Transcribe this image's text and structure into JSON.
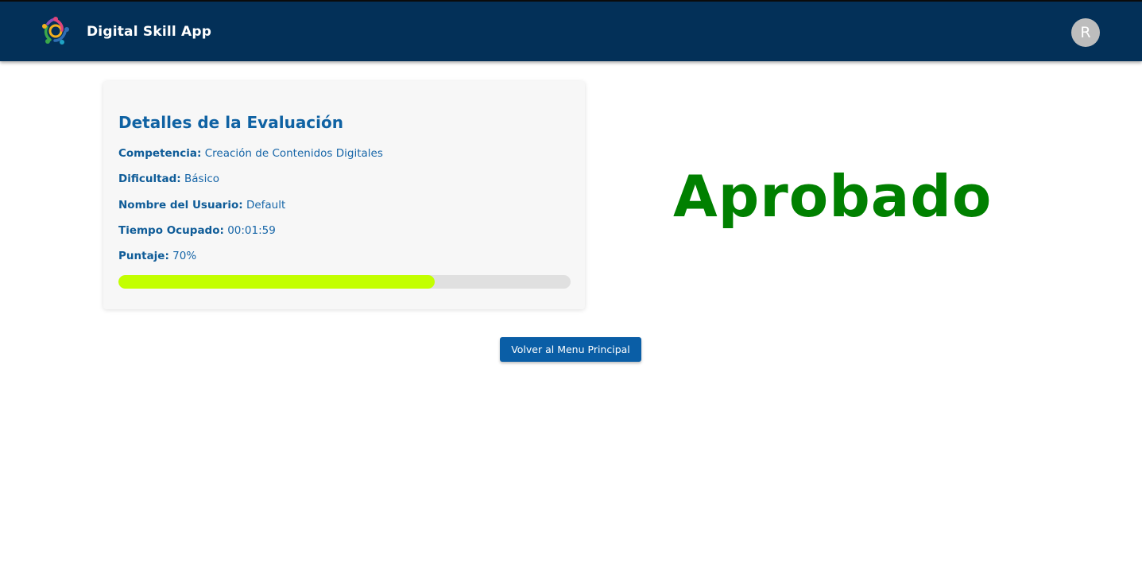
{
  "header": {
    "app_title": "Digital Skill App",
    "logo_icon": "people-circle-logo-icon",
    "avatar_initial": "R"
  },
  "evaluation": {
    "title": "Detalles de la Evaluación",
    "fields": [
      {
        "label": "Competencia:",
        "value": "Creación de Contenidos Digitales"
      },
      {
        "label": "Dificultad:",
        "value": "Básico"
      },
      {
        "label": "Nombre del Usuario:",
        "value": "Default"
      },
      {
        "label": "Tiempo Ocupado:",
        "value": "00:01:59"
      },
      {
        "label": "Puntaje:",
        "value": "70%"
      }
    ],
    "score_fraction": 0.7,
    "progress_color": "#c3ff00"
  },
  "result": {
    "status": "Aprobado",
    "color": "#008000"
  },
  "actions": {
    "back_label": "Volver al Menu Principal"
  },
  "colors": {
    "topbar": "#033058",
    "accent": "#0a5ea6"
  }
}
